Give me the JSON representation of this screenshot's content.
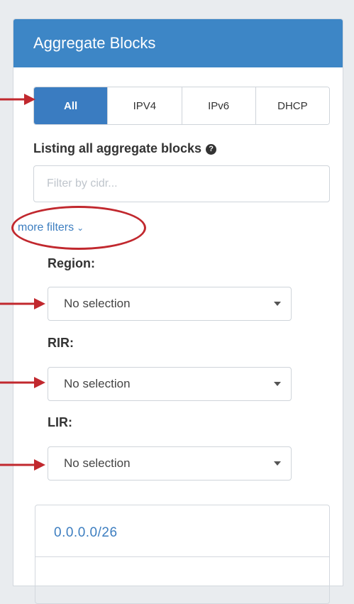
{
  "panel": {
    "title": "Aggregate Blocks"
  },
  "tabs": [
    {
      "label": "All",
      "active": true
    },
    {
      "label": "IPV4",
      "active": false
    },
    {
      "label": "IPv6",
      "active": false
    },
    {
      "label": "DHCP",
      "active": false
    }
  ],
  "listing": {
    "text": "Listing all aggregate blocks",
    "help_icon": "question-circle-icon"
  },
  "filter": {
    "placeholder": "Filter by cidr..."
  },
  "more_filters": {
    "label": "more filters",
    "icon": "chevron-down-icon"
  },
  "fields": [
    {
      "label": "Region:",
      "value": "No selection"
    },
    {
      "label": "RIR:",
      "value": "No selection"
    },
    {
      "label": "LIR:",
      "value": "No selection"
    }
  ],
  "results": [
    {
      "cidr": "0.0.0.0/26"
    }
  ],
  "colors": {
    "header": "#3d86c6",
    "active_tab": "#3a7cc1",
    "link": "#3d7ec0",
    "annotation": "#c1282e"
  }
}
